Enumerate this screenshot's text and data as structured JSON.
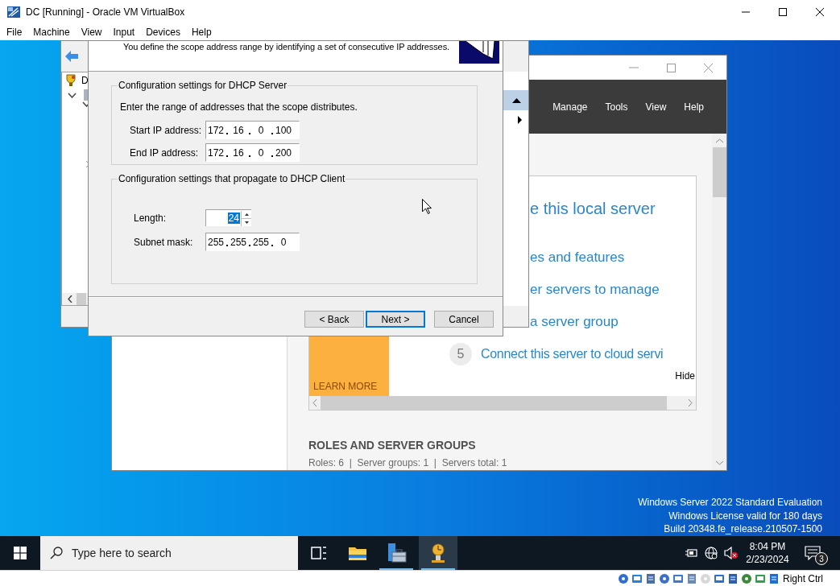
{
  "window": {
    "title": "DC [Running] - Oracle VM VirtualBox"
  },
  "menu": [
    {
      "label": "File"
    },
    {
      "label": "Machine"
    },
    {
      "label": "View"
    },
    {
      "label": "Input"
    },
    {
      "label": "Devices"
    },
    {
      "label": "Help"
    }
  ],
  "server_manager": {
    "menu": [
      {
        "label": "Manage"
      },
      {
        "label": "Tools"
      },
      {
        "label": "View"
      },
      {
        "label": "Help"
      }
    ],
    "welcome": {
      "heading": "e this local server",
      "links": [
        "es and features",
        "er servers to manage",
        "a server group"
      ],
      "step": {
        "number": "5",
        "text": "Connect this server to cloud servi"
      },
      "hide": "Hide",
      "learn_more": "LEARN MORE"
    },
    "roles": {
      "title": "ROLES AND SERVER GROUPS",
      "summary": "Roles: 6  |  Server groups: 1  |  Servers total: 1"
    }
  },
  "mmc": {
    "tree": {
      "label": "D"
    }
  },
  "wizard": {
    "description": "You define the scope address range by identifying a set of consecutive IP addresses.",
    "server_group": {
      "legend": "Configuration settings for DHCP Server",
      "hint": "Enter the range of addresses that the scope distributes.",
      "fields": [
        {
          "label": "Start IP address:",
          "octets": [
            "172",
            "16",
            "0",
            "100"
          ]
        },
        {
          "label": "End IP address:",
          "octets": [
            "172",
            "16",
            "0",
            "200"
          ]
        }
      ]
    },
    "client_group": {
      "legend": "Configuration settings that propagate to DHCP Client",
      "length": {
        "label": "Length:",
        "value": "24",
        "selected": true
      },
      "subnet": {
        "label": "Subnet mask:",
        "octets": [
          "255",
          "255",
          "255",
          "0"
        ]
      }
    },
    "buttons": [
      {
        "label": "< Back",
        "default": false
      },
      {
        "label": "Next >",
        "default": true
      },
      {
        "label": "Cancel",
        "default": false
      }
    ]
  },
  "desktop": {
    "edition_lines": [
      "Windows Server 2022 Standard Evaluation",
      "Windows License valid for 180 days",
      "Build 20348.fe_release.210507-1500"
    ]
  },
  "taskbar": {
    "search_placeholder": "Type here to search",
    "apps": [
      {
        "kind": "task-view",
        "open": false,
        "active": false
      },
      {
        "kind": "folder",
        "open": false,
        "active": false
      },
      {
        "kind": "server-manager",
        "open": true,
        "active": false
      },
      {
        "kind": "dhcp",
        "open": true,
        "active": true
      }
    ],
    "time": "8:04 PM",
    "date": "2/23/2024",
    "notifications": "3"
  },
  "status_bar": {
    "host_key": "Right Ctrl"
  }
}
